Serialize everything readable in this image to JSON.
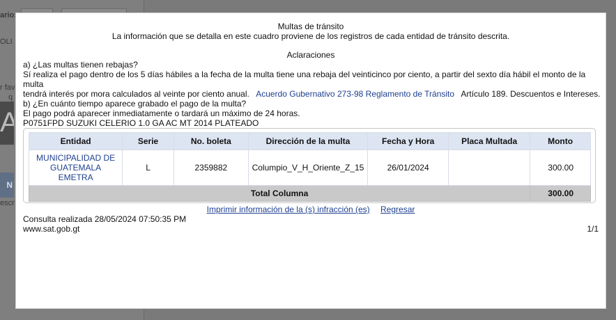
{
  "background": {
    "label_fragment": "ario:",
    "fragment_oli": "OLI",
    "fragment_fav": "r fav",
    "fragment_q": "q",
    "fragment_escr": "escr",
    "button_fragment": "N",
    "image_glyph": "A"
  },
  "modal": {
    "title": "Multas de tránsito",
    "subtitle": "La información que se detalla en este cuadro proviene de los registros de cada entidad de tránsito descrita.",
    "aclaraciones_heading": "Aclaraciones",
    "question_a": "a) ¿Las multas tienen rebajas?",
    "answer_a_part1": "Sí realiza el pago dentro de los 5 días hábiles a la fecha de la multa tiene una rebaja del veinticinco por ciento, a partir del sexto día hábil el monto de la multa",
    "answer_a_part2": "tendrá interés por mora calculados al veinte por ciento anual.",
    "answer_a_link": "Acuerdo Gubernativo 273-98 Reglamento de Tránsito",
    "answer_a_part3": "Artículo 189. Descuentos e Intereses.",
    "question_b": "b) ¿En cuánto tiempo aparece grabado el pago de la multa?",
    "answer_b": "El pago podrá aparecer inmediatamente o tardará un máximo de 24 horas.",
    "vehicle": "P0751FPD SUZUKI CELERIO 1.0 GA AC MT 2014 PLATEADO",
    "table": {
      "headers": {
        "entidad": "Entidad",
        "serie": "Serie",
        "boleta": "No. boleta",
        "direccion": "Dirección de la multa",
        "fecha": "Fecha y Hora",
        "placa": "Placa Multada",
        "monto": "Monto"
      },
      "rows": [
        {
          "entidad_line1": "MUNICIPALIDAD DE",
          "entidad_line2": "GUATEMALA",
          "entidad_line3": "EMETRA",
          "serie": "L",
          "boleta": "2359882",
          "direccion": "Columpio_V_H_Oriente_Z_15",
          "fecha": "26/01/2024",
          "placa": "",
          "monto": "300.00"
        }
      ],
      "total_label": "Total Columna",
      "total_value": "300.00"
    },
    "print_link": "Imprimir información de la (s) infracción (es)",
    "back_link": "Regresar",
    "consulta": "Consulta realizada 28/05/2024 07:50:35 PM",
    "footer_url": "www.sat.gob.gt",
    "page_indicator": "1/1"
  }
}
